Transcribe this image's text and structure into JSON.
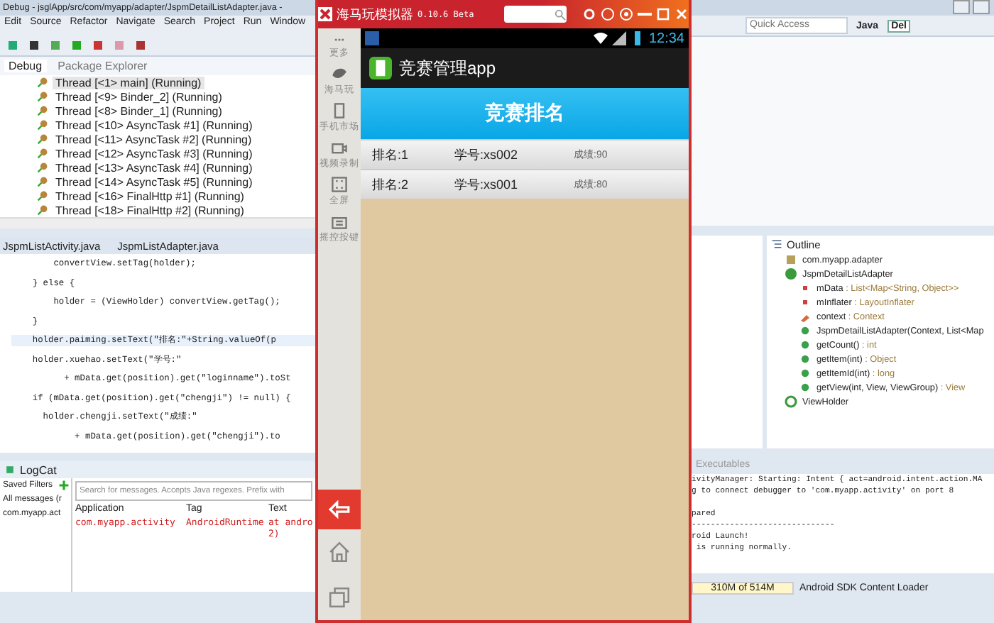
{
  "ide": {
    "title": "Debug - jsglApp/src/com/myapp/adapter/JspmDetailListAdapter.java -",
    "menu": [
      "Edit",
      "Source",
      "Refactor",
      "Navigate",
      "Search",
      "Project",
      "Run",
      "Window"
    ],
    "views": [
      {
        "label": "Debug",
        "selected": true
      },
      {
        "label": "Package Explorer",
        "selected": false
      }
    ],
    "threads": [
      {
        "label": "Thread [<1> main] (Running)",
        "selected": true
      },
      {
        "label": "Thread [<9> Binder_2] (Running)",
        "selected": false
      },
      {
        "label": "Thread [<8> Binder_1] (Running)",
        "selected": false
      },
      {
        "label": "Thread [<10> AsyncTask #1] (Running)",
        "selected": false
      },
      {
        "label": "Thread [<11> AsyncTask #2] (Running)",
        "selected": false
      },
      {
        "label": "Thread [<12> AsyncTask #3] (Running)",
        "selected": false
      },
      {
        "label": "Thread [<13> AsyncTask #4] (Running)",
        "selected": false
      },
      {
        "label": "Thread [<14> AsyncTask #5] (Running)",
        "selected": false
      },
      {
        "label": "Thread [<16> FinalHttp #1] (Running)",
        "selected": false
      },
      {
        "label": "Thread [<18> FinalHttp #2] (Running)",
        "selected": false
      }
    ],
    "editor_tabs": [
      "JspmListActivity.java",
      "JspmListAdapter.java"
    ],
    "code": [
      {
        "text": "        convertView.setTag(holder);",
        "current": false
      },
      {
        "text": "    } else {",
        "current": false
      },
      {
        "text": "        holder = (ViewHolder) convertView.getTag();",
        "current": false
      },
      {
        "text": "    }",
        "current": false
      },
      {
        "text": "    holder.paiming.setText(\"排名:\"+String.valueOf(p",
        "current": true
      },
      {
        "text": "    holder.xuehao.setText(\"学号:\"",
        "current": false
      },
      {
        "text": "          + mData.get(position).get(\"loginname\").toSt",
        "current": false
      },
      {
        "text": "    if (mData.get(position).get(\"chengji\") != null) {",
        "current": false
      },
      {
        "text": "      holder.chengji.setText(\"成绩:\"",
        "current": false
      },
      {
        "text": "            + mData.get(position).get(\"chengji\").to",
        "current": false
      }
    ],
    "logcat": {
      "title": "LogCat",
      "filters_title": "Saved Filters",
      "filters": [
        "All messages (r",
        "com.myapp.act"
      ],
      "search": {
        "placeholder": "Search for messages. Accepts Java regexes. Prefix with"
      },
      "columns": [
        "Application",
        "Tag",
        "Text"
      ],
      "rows": [
        {
          "application": "com.myapp.activity",
          "tag": "AndroidRuntime",
          "text": [
            "at andro",
            "2)"
          ]
        }
      ]
    },
    "quick_access": {
      "placeholder": "Quick Access"
    },
    "perspectives": [
      {
        "label": "Java",
        "selected": false
      },
      {
        "label": "Del",
        "selected": true
      }
    ],
    "outline": {
      "title": "Outline",
      "items": [
        {
          "kind": "package",
          "name": "com.myapp.adapter"
        },
        {
          "kind": "class",
          "name": "JspmDetailListAdapter"
        },
        {
          "kind": "field",
          "name": "mData",
          "type": " : List<Map<String, Object>>"
        },
        {
          "kind": "field",
          "name": "mInflater",
          "type": " : LayoutInflater"
        },
        {
          "kind": "protected",
          "name": "context",
          "type": " : Context"
        },
        {
          "kind": "constructor",
          "name": "JspmDetailListAdapter(Context, List<Map"
        },
        {
          "kind": "method",
          "name": "getCount()",
          "type": " : int"
        },
        {
          "kind": "method",
          "name": "getItem(int)",
          "type": " : Object"
        },
        {
          "kind": "method",
          "name": "getItemId(int)",
          "type": " : long"
        },
        {
          "kind": "method",
          "name": "getView(int, View, ViewGroup)",
          "type": " : View"
        },
        {
          "kind": "inner",
          "name": "ViewHolder"
        }
      ]
    },
    "console_tab": "Executables",
    "console": [
      "ivityManager: Starting: Intent { act=android.intent.action.MA",
      "g to connect debugger to 'com.myapp.activity' on port 8",
      "pared",
      "------------------------------",
      "roid Launch!",
      " is running normally."
    ],
    "heap": "310M of 514M",
    "status": "Android SDK Content Loader"
  },
  "emulator": {
    "title": "海马玩模拟器",
    "version": "0.10.6 Beta",
    "sidebar": [
      {
        "kind": "dots",
        "label": "更多"
      },
      {
        "kind": "leaf",
        "label": "海马玩"
      },
      {
        "kind": "phone",
        "label": "手机市场"
      },
      {
        "kind": "camera",
        "label": "视频录制"
      },
      {
        "kind": "full",
        "label": "全屏"
      },
      {
        "kind": "keys",
        "label": "摇控按键"
      }
    ],
    "time": "12:34",
    "app_title": "竞赛管理app",
    "header": "竞赛排名",
    "rows": [
      {
        "rank": "排名:1",
        "id": "学号:xs002",
        "score": "成绩:90"
      },
      {
        "rank": "排名:2",
        "id": "学号:xs001",
        "score": "成绩:80"
      }
    ]
  }
}
